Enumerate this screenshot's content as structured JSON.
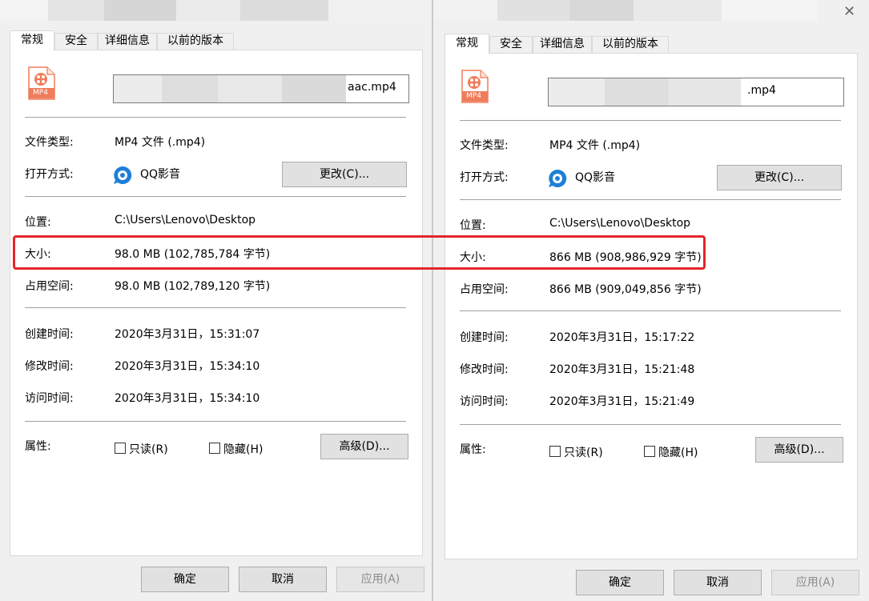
{
  "colors": {
    "dialog_bg": "#f0f0f0",
    "panel_bg": "#ffffff",
    "highlight": "#e3262a",
    "file_icon": "#ef7c5a"
  },
  "icons": {
    "file": "mp4-file-icon",
    "player": "qq-player-icon",
    "close": "close-icon"
  },
  "left": {
    "tabs": [
      "常规",
      "安全",
      "详细信息",
      "以前的版本"
    ],
    "file_icon_label": "MP4",
    "filename_visible": "aac.mp4",
    "type_label": "文件类型:",
    "type_value": "MP4 文件 (.mp4)",
    "open_label": "打开方式:",
    "open_value": "QQ影音",
    "change_button": "更改(C)...",
    "location_label": "位置:",
    "location_value": "C:\\Users\\Lenovo\\Desktop",
    "size_label": "大小:",
    "size_value": "98.0 MB (102,785,784 字节)",
    "disk_label": "占用空间:",
    "disk_value": "98.0 MB (102,789,120 字节)",
    "created_label": "创建时间:",
    "created_value": "2020年3月31日，15:31:07",
    "modified_label": "修改时间:",
    "modified_value": "2020年3月31日，15:34:10",
    "accessed_label": "访问时间:",
    "accessed_value": "2020年3月31日，15:34:10",
    "attr_label": "属性:",
    "readonly_label": "只读(R)",
    "hidden_label": "隐藏(H)",
    "advanced_button": "高级(D)...",
    "ok_button": "确定",
    "cancel_button": "取消",
    "apply_button": "应用(A)"
  },
  "right": {
    "tabs": [
      "常规",
      "安全",
      "详细信息",
      "以前的版本"
    ],
    "file_icon_label": "MP4",
    "filename_visible": ".mp4",
    "type_label": "文件类型:",
    "type_value": "MP4 文件 (.mp4)",
    "open_label": "打开方式:",
    "open_value": "QQ影音",
    "change_button": "更改(C)...",
    "location_label": "位置:",
    "location_value": "C:\\Users\\Lenovo\\Desktop",
    "size_label": "大小:",
    "size_value": "866 MB (908,986,929 字节)",
    "disk_label": "占用空间:",
    "disk_value": "866 MB (909,049,856 字节)",
    "created_label": "创建时间:",
    "created_value": "2020年3月31日，15:17:22",
    "modified_label": "修改时间:",
    "modified_value": "2020年3月31日，15:21:48",
    "accessed_label": "访问时间:",
    "accessed_value": "2020年3月31日，15:21:49",
    "attr_label": "属性:",
    "readonly_label": "只读(R)",
    "hidden_label": "隐藏(H)",
    "advanced_button": "高级(D)...",
    "ok_button": "确定",
    "cancel_button": "取消",
    "apply_button": "应用(A)"
  }
}
